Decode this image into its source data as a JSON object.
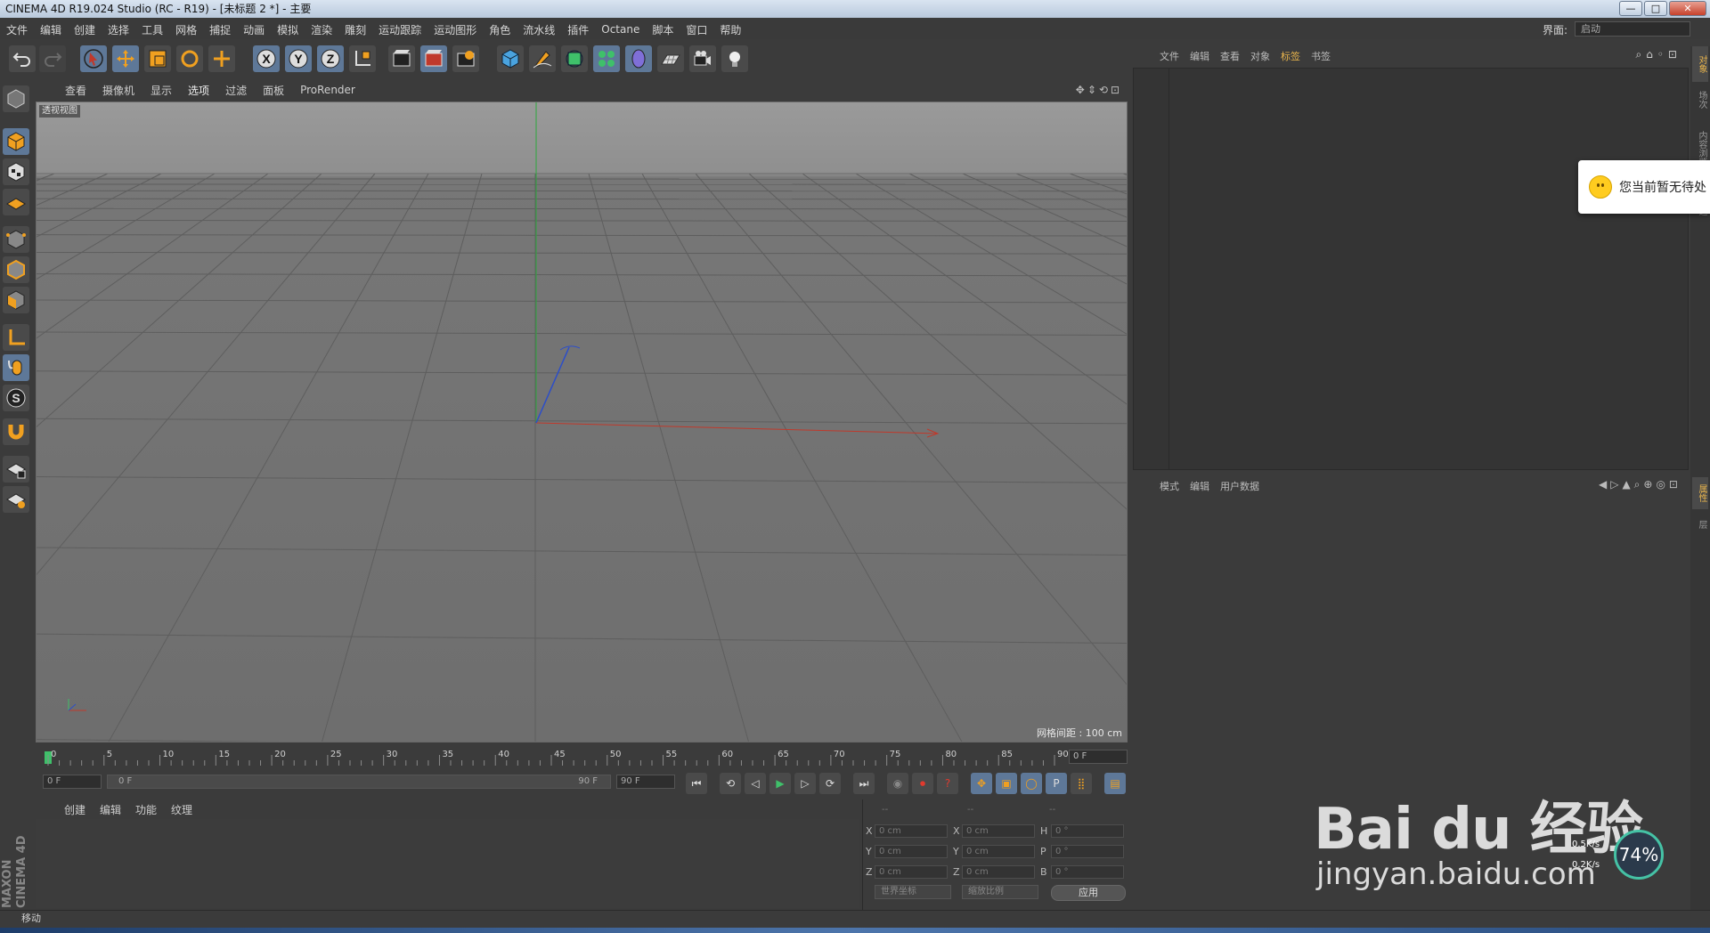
{
  "window": {
    "title": "CINEMA 4D R19.024 Studio (RC - R19) - [未标题 2 *] - 主要",
    "minimize": "—",
    "maximize": "□",
    "close": "✕"
  },
  "menubar": {
    "items": [
      "文件",
      "编辑",
      "创建",
      "选择",
      "工具",
      "网格",
      "捕捉",
      "动画",
      "模拟",
      "渲染",
      "雕刻",
      "运动跟踪",
      "运动图形",
      "角色",
      "流水线",
      "插件",
      "Octane",
      "脚本",
      "窗口",
      "帮助"
    ],
    "layout_label": "界面:",
    "layout_value": "启动"
  },
  "toolbar": {
    "buttons": [
      "undo-icon",
      "redo-icon",
      "select-icon",
      "move-icon",
      "scale-icon",
      "rotate-icon",
      "live-select-icon",
      "x-axis-icon",
      "y-axis-icon",
      "z-axis-icon",
      "coordinate-system-icon",
      "render-view-icon",
      "render-picture-viewer-icon",
      "render-settings-icon",
      "cube-icon",
      "pen-icon",
      "subdivision-icon",
      "cloner-icon",
      "deformer-icon",
      "floor-icon",
      "camera-icon",
      "light-icon"
    ],
    "axis_x": "X",
    "axis_y": "Y",
    "axis_z": "Z"
  },
  "viewport": {
    "menu": [
      "查看",
      "摄像机",
      "显示",
      "选项",
      "过滤",
      "面板",
      "ProRender"
    ],
    "label": "透视视图",
    "grid_spacing": "网格间距 : 100 cm"
  },
  "timeline": {
    "ticks": [
      "0",
      "5",
      "10",
      "15",
      "20",
      "25",
      "30",
      "35",
      "40",
      "45",
      "50",
      "55",
      "60",
      "65",
      "70",
      "75",
      "80",
      "85",
      "90"
    ],
    "current_frame": "0 F",
    "start_field": "0 F",
    "range_start": "0 F",
    "range_end": "90 F",
    "end_field": "90 F"
  },
  "material_manager": {
    "menu": [
      "创建",
      "编辑",
      "功能",
      "纹理"
    ]
  },
  "coordinates": {
    "heads": [
      "--",
      "--",
      "--"
    ],
    "rows": [
      {
        "a": "X",
        "av": "0 cm",
        "b": "X",
        "bv": "0 cm",
        "c": "H",
        "cv": "0 °"
      },
      {
        "a": "Y",
        "av": "0 cm",
        "b": "Y",
        "bv": "0 cm",
        "c": "P",
        "cv": "0 °"
      },
      {
        "a": "Z",
        "av": "0 cm",
        "b": "Z",
        "bv": "0 cm",
        "c": "B",
        "cv": "0 °"
      }
    ],
    "dropdown_world": "世界坐标",
    "dropdown_scale": "缩放比例",
    "apply": "应用"
  },
  "object_manager": {
    "menu": [
      "文件",
      "编辑",
      "查看",
      "对象",
      "标签",
      "书签"
    ],
    "active_tab": "标签"
  },
  "attribute_manager": {
    "menu": [
      "模式",
      "编辑",
      "用户数据"
    ]
  },
  "right_tabs": [
    "对象",
    "场次",
    "内容浏览器",
    "构造",
    "属性",
    "层"
  ],
  "status": {
    "text": "移动"
  },
  "notification": {
    "text": "您当前暂无待处"
  },
  "watermark": {
    "brand": "Bai du 经验",
    "url": "jingyan.baidu.com"
  },
  "net_meter": {
    "percent": "74%",
    "up": "0.5K/s",
    "down": "0.2K/s"
  },
  "logo": {
    "text": "MAXON CINEMA 4D"
  },
  "colors": {
    "accent": "#e8b44c",
    "active_button": "#5e7898",
    "x_axis": "#c0392b",
    "y_axis": "#27ae60",
    "z_axis": "#2c4ec9"
  }
}
